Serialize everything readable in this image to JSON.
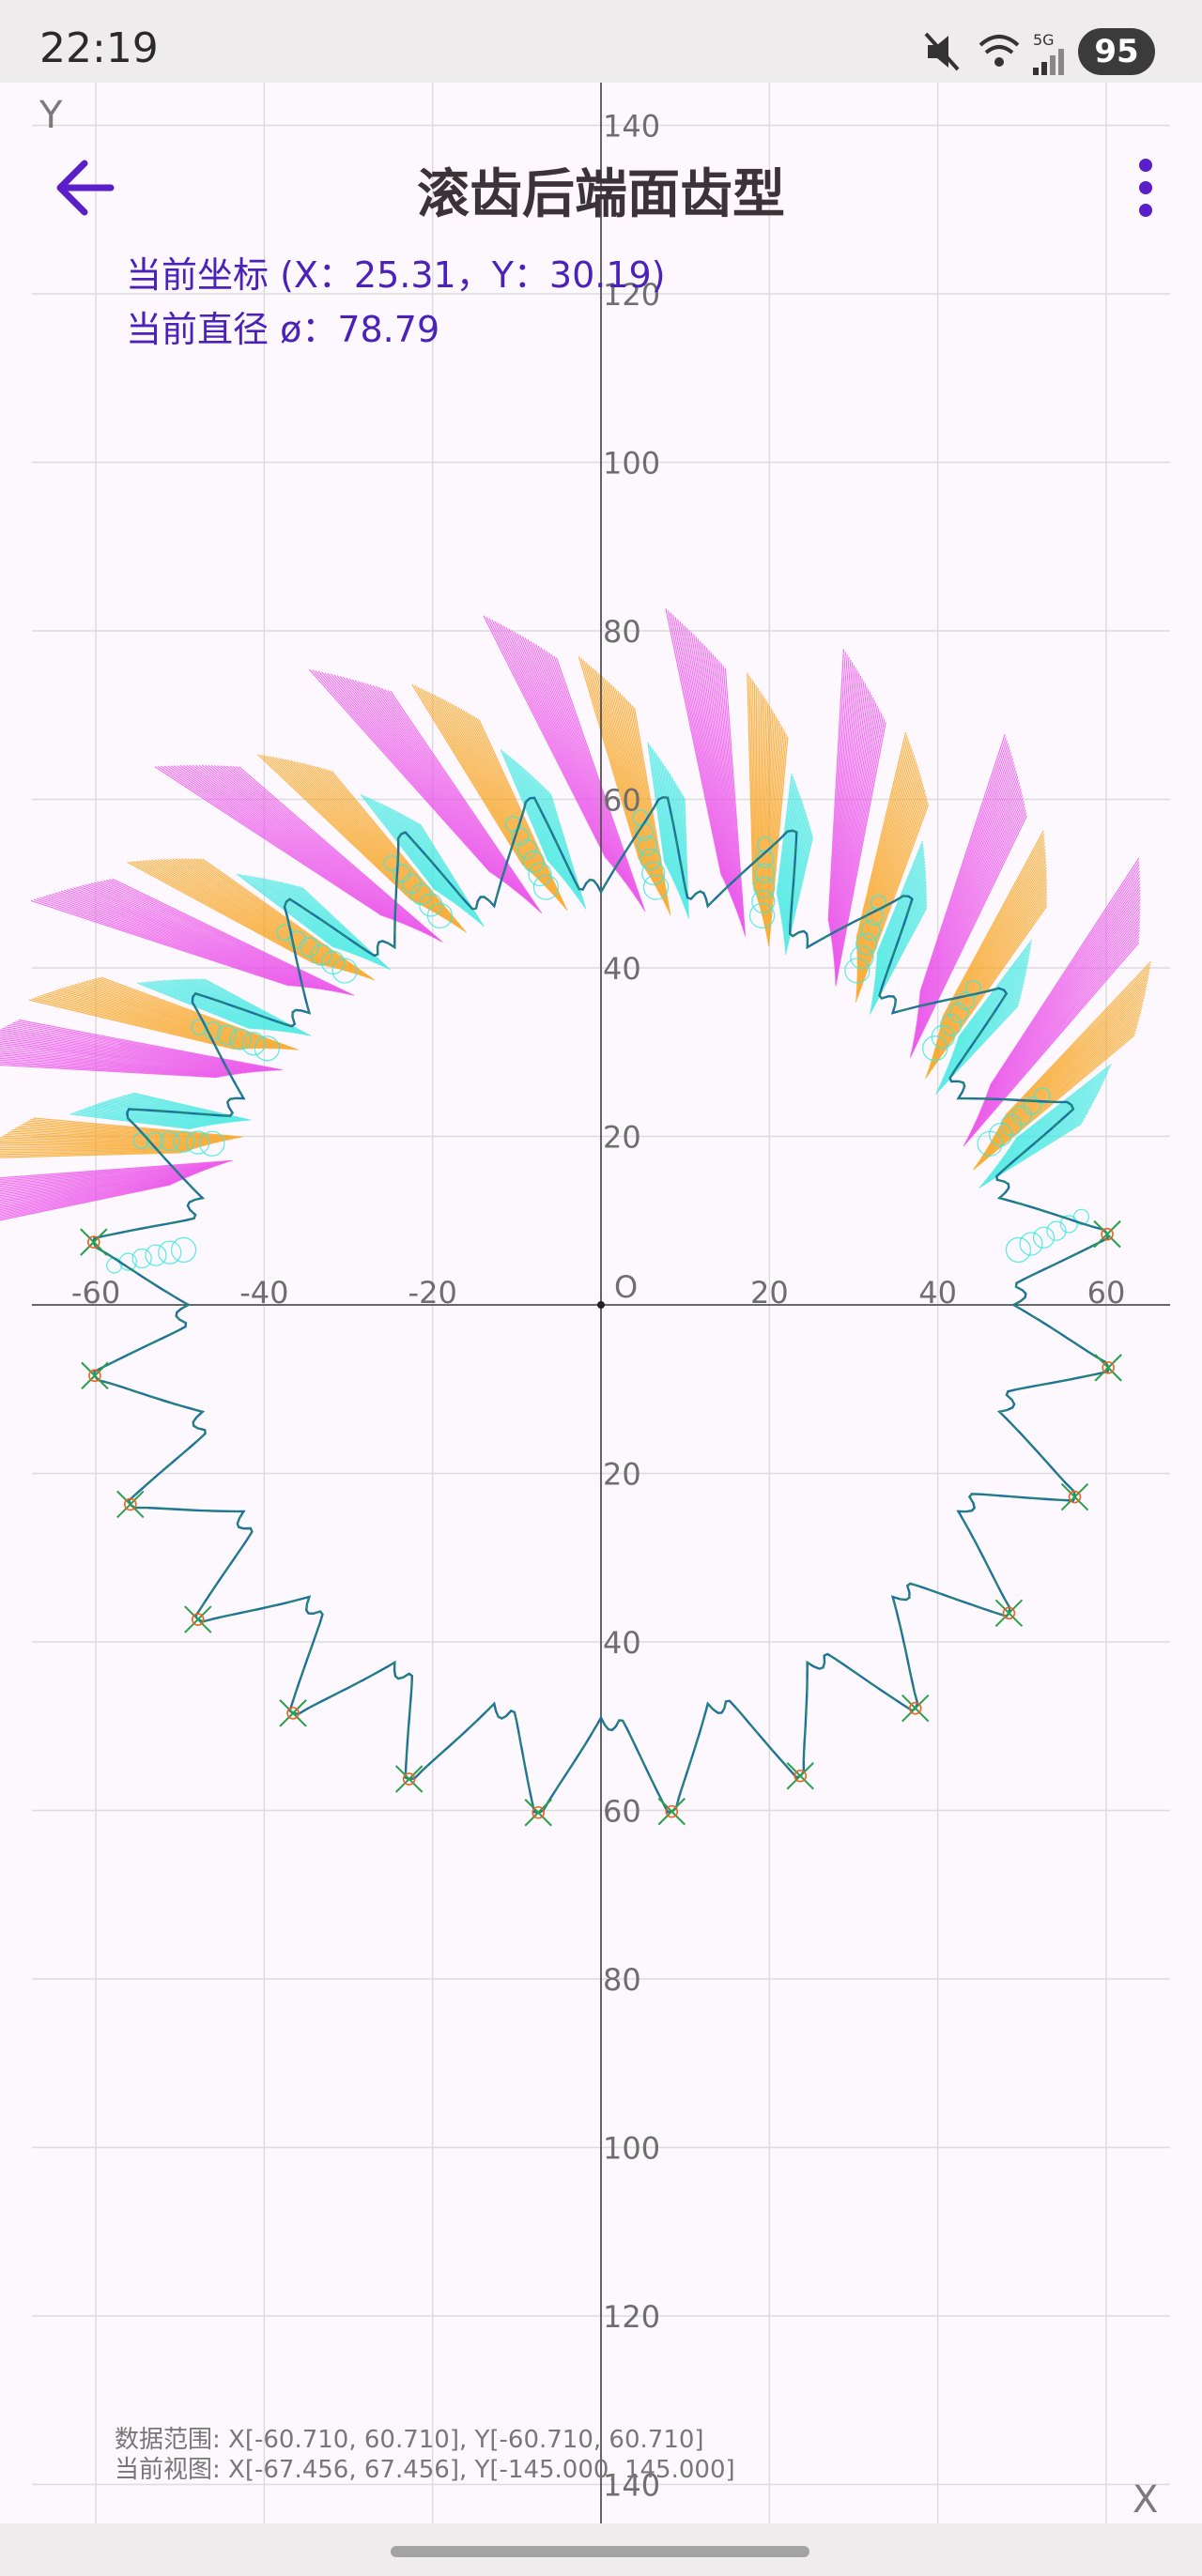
{
  "status_bar": {
    "time": "22:19",
    "battery": "95",
    "network": "5G",
    "icons": [
      "mute-icon",
      "wifi-icon",
      "signal-icon"
    ]
  },
  "app_bar": {
    "title": "滚齿后端面齿型",
    "back_icon": "arrow-left-icon",
    "menu_icon": "more-vert-icon",
    "accent_color": "#5a1fc9"
  },
  "info": {
    "current_coords": "当前坐标 (X：25.31，Y：30.19)",
    "current_diameter": "当前直径 ø：78.79"
  },
  "footer": {
    "data_range": "数据范围: X[-60.710, 60.710], Y[-60.710, 60.710]",
    "current_view": "当前视图: X[-67.456, 67.456], Y[-145.000, 145.000]"
  },
  "axes": {
    "x_letter": "X",
    "y_letter": "Y",
    "origin_label": "O"
  },
  "chart_data": {
    "type": "scatter",
    "x_ticks": [
      "-60",
      "-40",
      "-20",
      "20",
      "40",
      "60"
    ],
    "y_ticks": [
      "140",
      "120",
      "100",
      "80",
      "60",
      "40",
      "20",
      "20",
      "40",
      "60",
      "80",
      "100",
      "120",
      "140"
    ],
    "y_tick_values": [
      140,
      120,
      100,
      80,
      60,
      40,
      20,
      -20,
      -40,
      -60,
      -80,
      -100,
      -120,
      -140
    ],
    "x_tick_values": [
      -60,
      -40,
      -20,
      20,
      40,
      60
    ],
    "xlim": [
      -67.456,
      67.456
    ],
    "ylim": [
      -145.0,
      145.0
    ],
    "tooth_count": 24,
    "tip_radius": 60.71,
    "root_radius": 49.0,
    "grid": true,
    "colors": {
      "profile": "#1d6f9c",
      "profile_alt": "#2aa04a",
      "marker": "#e8632a",
      "trail_cyan": "#39e8e0",
      "trail_orange": "#f7a21a",
      "trail_magenta": "#e94ee8",
      "axis": "#555555",
      "grid": "#dcdcdc"
    }
  }
}
